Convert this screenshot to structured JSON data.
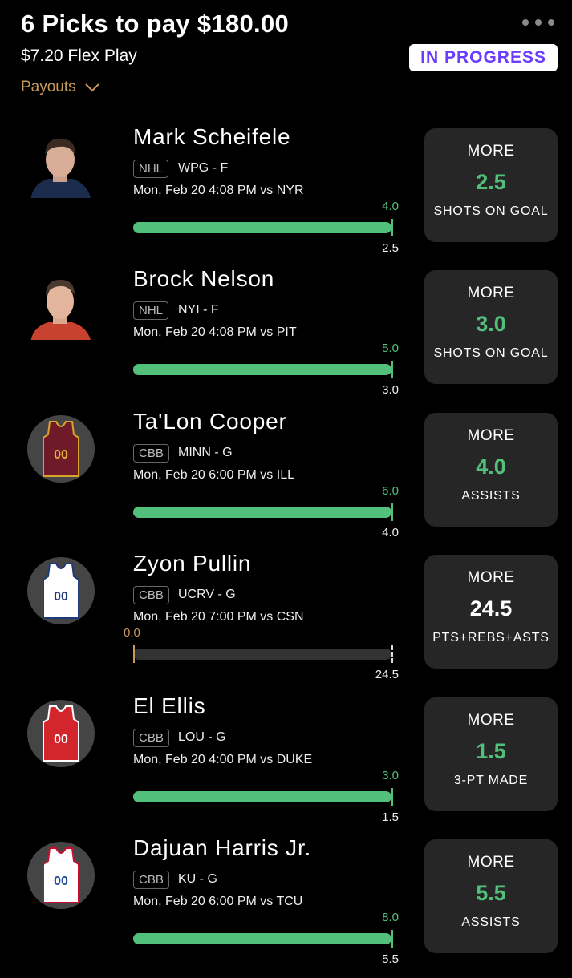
{
  "header": {
    "title": "6 Picks to pay $180.00",
    "subtitle": "$7.20 Flex Play",
    "payouts_label": "Payouts",
    "status": "IN PROGRESS"
  },
  "picks": [
    {
      "name": "Mark Scheifele",
      "league": "NHL",
      "team": "WPG - F",
      "when": "Mon, Feb 20 4:08 PM  vs NYR",
      "current": "4.0",
      "line": "2.5",
      "progress": 1.0,
      "direction": "MORE",
      "value": "2.5",
      "stat": "SHOTS ON GOAL"
    },
    {
      "name": "Brock Nelson",
      "league": "NHL",
      "team": "NYI - F",
      "when": "Mon, Feb 20 4:08 PM  vs PIT",
      "current": "5.0",
      "line": "3.0",
      "progress": 1.0,
      "direction": "MORE",
      "value": "3.0",
      "stat": "SHOTS ON GOAL"
    },
    {
      "name": "Ta'Lon Cooper",
      "league": "CBB",
      "team": "MINN - G",
      "when": "Mon, Feb 20 6:00 PM  vs ILL",
      "current": "6.0",
      "line": "4.0",
      "progress": 1.0,
      "direction": "MORE",
      "value": "4.0",
      "stat": "ASSISTS"
    },
    {
      "name": "Zyon Pullin",
      "league": "CBB",
      "team": "UCRV - G",
      "when": "Mon, Feb 20 7:00 PM  vs CSN",
      "current": "0.0",
      "line": "24.5",
      "progress": 0.0,
      "direction": "MORE",
      "value": "24.5",
      "stat": "PTS+REBS+ASTS"
    },
    {
      "name": "El Ellis",
      "league": "CBB",
      "team": "LOU - G",
      "when": "Mon, Feb 20 4:00 PM  vs DUKE",
      "current": "3.0",
      "line": "1.5",
      "progress": 1.0,
      "direction": "MORE",
      "value": "1.5",
      "stat": "3-PT MADE"
    },
    {
      "name": "Dajuan Harris Jr.",
      "league": "CBB",
      "team": "KU - G",
      "when": "Mon, Feb 20 6:00 PM  vs TCU",
      "current": "8.0",
      "line": "5.5",
      "progress": 1.0,
      "direction": "MORE",
      "value": "5.5",
      "stat": "ASSISTS"
    }
  ],
  "colors": {
    "accent_green": "#52c07a",
    "accent_orange": "#c79a5c",
    "status_purple": "#6a3cff"
  }
}
